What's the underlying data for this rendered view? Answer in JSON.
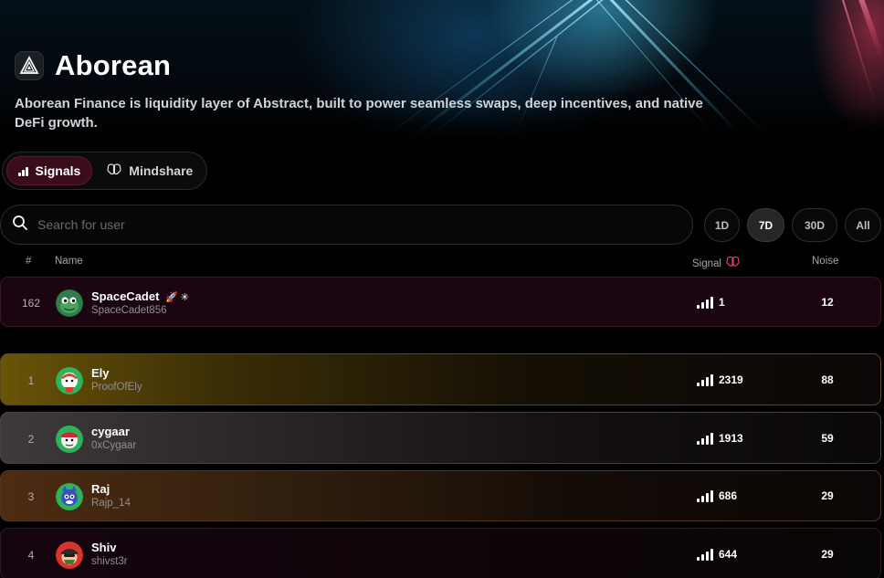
{
  "project": {
    "title": "Aborean",
    "description": "Aborean Finance is liquidity layer of Abstract, built to power seamless swaps, deep incentives, and native DeFi growth.",
    "logo_icon": "aborean-logo-icon"
  },
  "view_tabs": [
    {
      "label": "Signals",
      "icon": "signal-bars-icon",
      "active": true
    },
    {
      "label": "Mindshare",
      "icon": "brain-icon",
      "active": false
    }
  ],
  "search": {
    "placeholder": "Search for user",
    "value": ""
  },
  "periods": [
    {
      "label": "1D",
      "active": false
    },
    {
      "label": "7D",
      "active": true
    },
    {
      "label": "30D",
      "active": false
    },
    {
      "label": "All",
      "active": false
    }
  ],
  "columns": {
    "rank": "#",
    "name": "Name",
    "signal": "Signal",
    "noise": "Noise"
  },
  "current_user": {
    "rank": "162",
    "name": "SpaceCadet",
    "badges": "🚀 ✳",
    "handle": "SpaceCadet856",
    "signal": "1",
    "noise": "12"
  },
  "leaderboard": [
    {
      "rank": "1",
      "name": "Ely",
      "handle": "ProofOfEly",
      "signal": "2319",
      "noise": "88"
    },
    {
      "rank": "2",
      "name": "cygaar",
      "handle": "0xCygaar",
      "signal": "1913",
      "noise": "59"
    },
    {
      "rank": "3",
      "name": "Raj",
      "handle": "Rajp_14",
      "signal": "686",
      "noise": "29"
    },
    {
      "rank": "4",
      "name": "Shiv",
      "handle": "shivst3r",
      "signal": "644",
      "noise": "29"
    }
  ],
  "colors": {
    "accent": "#3a0c1d",
    "current_row": "#1a0510",
    "gold": "#5a4708",
    "silver": "#3a3638",
    "bronze": "#4a2a12"
  }
}
